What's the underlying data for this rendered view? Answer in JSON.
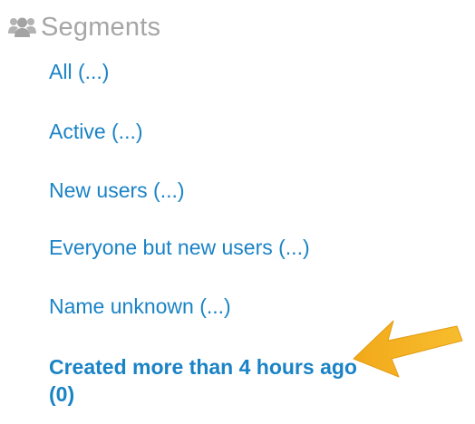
{
  "segments": {
    "title": "Segments",
    "header_icon": "users-icon",
    "items": [
      {
        "label": "All (...)",
        "selected": false
      },
      {
        "label": "Active (...)",
        "selected": false
      },
      {
        "label": "New users (...)",
        "selected": false
      },
      {
        "label": "Everyone but new users (...)",
        "selected": false
      },
      {
        "label": "Name unknown (...)",
        "selected": false
      },
      {
        "label": "Created more than 4 hours ago (0)",
        "selected": true
      }
    ]
  },
  "annotation": {
    "icon": "arrow-icon",
    "color": "#f5b21a"
  },
  "colors": {
    "link": "#1a83c6",
    "header": "#a6a6a6"
  }
}
